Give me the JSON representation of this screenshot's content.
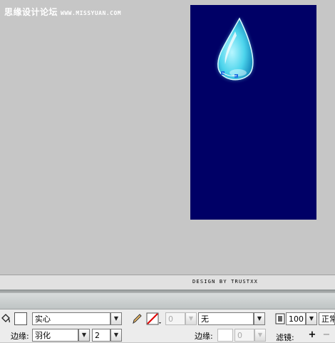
{
  "watermark": {
    "brand": "思缘设计论坛",
    "site": "WWW.MISSYUAN.COM"
  },
  "credit": "DESIGN BY TRUSTXX",
  "colors": {
    "stage": "#000066",
    "drop": "#5fe0f0"
  },
  "toolbar": {
    "fill_style": "实心",
    "edge_label": "边缘:",
    "edge_value": "羽化",
    "feather_amount": "2",
    "stroke_width": "0",
    "stroke_style": "无",
    "edge_label2": "边缘:",
    "edge_amount2": "0",
    "opacity": "100",
    "blend_mode": "正常",
    "filters_label": "滤镜:"
  },
  "icons": [
    "paint-bucket-icon",
    "pencil-icon",
    "no-stroke-icon",
    "effect-icon",
    "add-filter-icon",
    "remove-filter-icon"
  ]
}
